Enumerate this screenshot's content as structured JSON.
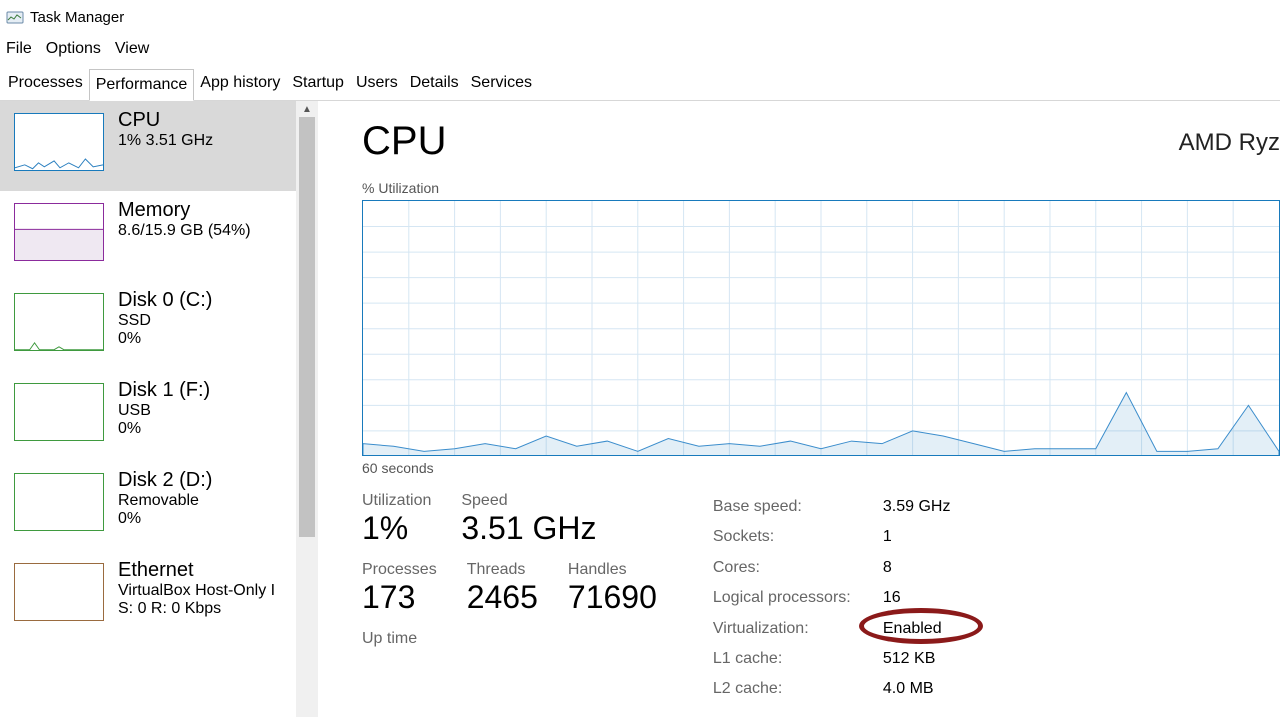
{
  "window": {
    "title": "Task Manager"
  },
  "menu": {
    "file": "File",
    "options": "Options",
    "view": "View"
  },
  "tabs": {
    "processes": "Processes",
    "performance": "Performance",
    "app_history": "App history",
    "startup": "Startup",
    "users": "Users",
    "details": "Details",
    "services": "Services"
  },
  "sidebar": {
    "cpu": {
      "title": "CPU",
      "sub": "1%  3.51 GHz"
    },
    "memory": {
      "title": "Memory",
      "sub": "8.6/15.9 GB (54%)"
    },
    "disk0": {
      "title": "Disk 0 (C:)",
      "sub1": "SSD",
      "sub2": "0%"
    },
    "disk1": {
      "title": "Disk 1 (F:)",
      "sub1": "USB",
      "sub2": "0%"
    },
    "disk2": {
      "title": "Disk 2 (D:)",
      "sub1": "Removable",
      "sub2": "0%"
    },
    "eth": {
      "title": "Ethernet",
      "sub1": "VirtualBox Host-Only I",
      "sub2": "S: 0  R: 0 Kbps"
    }
  },
  "main": {
    "title": "CPU",
    "cpu_name": "AMD Ryz",
    "chart_label": "% Utilization",
    "time_label": "60 seconds",
    "utilization": {
      "label": "Utilization",
      "value": "1%"
    },
    "speed": {
      "label": "Speed",
      "value": "3.51 GHz"
    },
    "processes": {
      "label": "Processes",
      "value": "173"
    },
    "threads": {
      "label": "Threads",
      "value": "2465"
    },
    "handles": {
      "label": "Handles",
      "value": "71690"
    },
    "uptime": {
      "label": "Up time"
    },
    "right": {
      "base_speed": {
        "label": "Base speed:",
        "value": "3.59 GHz"
      },
      "sockets": {
        "label": "Sockets:",
        "value": "1"
      },
      "cores": {
        "label": "Cores:",
        "value": "8"
      },
      "logical": {
        "label": "Logical processors:",
        "value": "16"
      },
      "virt": {
        "label": "Virtualization:",
        "value": "Enabled"
      },
      "l1": {
        "label": "L1 cache:",
        "value": "512 KB"
      },
      "l2": {
        "label": "L2 cache:",
        "value": "4.0 MB"
      }
    }
  },
  "chart_data": {
    "type": "line",
    "title": "% Utilization",
    "xlabel": "60 seconds",
    "ylabel": "% Utilization",
    "xlim": [
      0,
      60
    ],
    "ylim": [
      0,
      100
    ],
    "x": [
      0,
      2,
      4,
      6,
      8,
      10,
      12,
      14,
      16,
      18,
      20,
      22,
      24,
      26,
      28,
      30,
      32,
      34,
      36,
      38,
      40,
      42,
      44,
      46,
      48,
      50,
      52,
      54,
      56,
      58,
      60
    ],
    "values": [
      5,
      4,
      2,
      3,
      5,
      3,
      8,
      4,
      6,
      2,
      7,
      4,
      5,
      4,
      6,
      3,
      6,
      5,
      10,
      8,
      5,
      2,
      3,
      3,
      3,
      25,
      2,
      2,
      3,
      20,
      2
    ]
  }
}
